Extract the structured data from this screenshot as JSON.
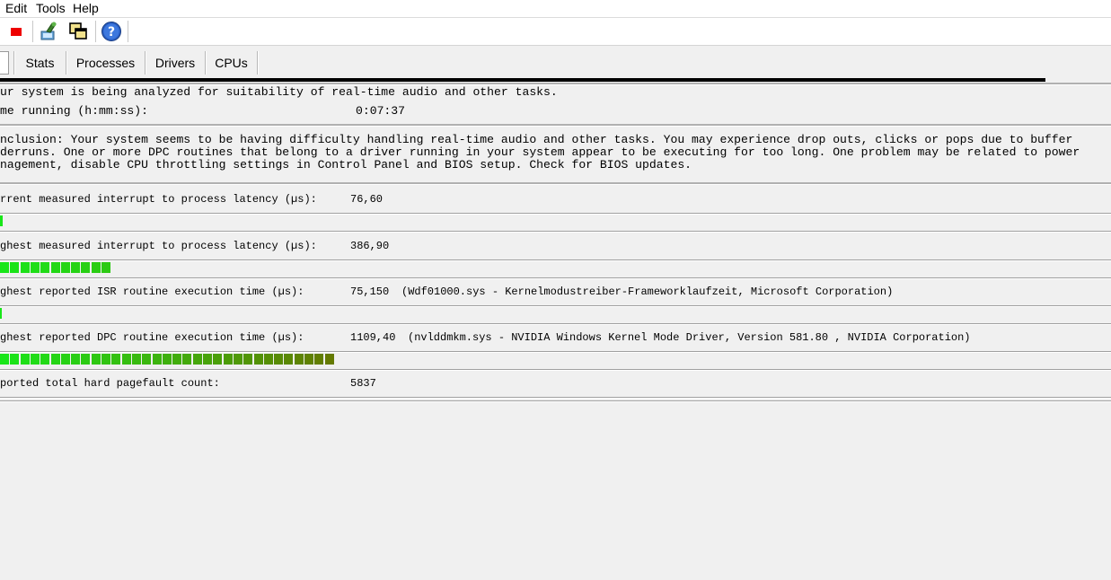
{
  "menu": {
    "items": [
      "Edit",
      "Tools",
      "Help"
    ]
  },
  "toolbar": {
    "buttons": [
      {
        "name": "stop-icon",
        "color": "#ee0000"
      },
      {
        "name": "analyze-icon",
        "color": "#3a7f2a"
      },
      {
        "name": "windows-icon",
        "color": "#f2e28c"
      },
      {
        "name": "help-icon",
        "color": "#2a5fc4"
      }
    ]
  },
  "tabs": [
    "Stats",
    "Processes",
    "Drivers",
    "CPUs"
  ],
  "stats": {
    "status_line": "ur system is being analyzed for suitability of real-time audio and other tasks.",
    "time_label": "me running (h:mm:ss):",
    "time_value": "0:07:37",
    "conclusion_1": "nclusion: Your system seems to be having difficulty handling real-time audio and other tasks. You may experience drop outs, clicks or pops due to buffer",
    "conclusion_2": "derruns. One or more DPC routines that belong to a driver running in your system appear to be executing for too long. One problem may be related to power",
    "conclusion_3": "nagement, disable CPU throttling settings in Control Panel and BIOS setup. Check for BIOS updates.",
    "metrics": [
      {
        "label": "rrent measured interrupt to process latency (µs):",
        "value": "76,60",
        "detail": "",
        "bar_segments": 1
      },
      {
        "label": "ghest measured interrupt to process latency (µs):",
        "value": "386,90",
        "detail": "",
        "bar_segments": 11
      },
      {
        "label": "ghest reported ISR routine execution time (µs):",
        "value": "75,150",
        "detail": "(Wdf01000.sys - Kernelmodustreiber-Frameworklaufzeit, Microsoft Corporation)",
        "bar_segments": 0
      },
      {
        "label": "ghest reported DPC routine execution time (µs):",
        "value": "1109,40",
        "detail": "(nvlddmkm.sys - NVIDIA Windows Kernel Mode Driver, Version 581.80 , NVIDIA Corporation)",
        "bar_segments": 33
      },
      {
        "label": "ported total hard pagefault count:",
        "value": "5837",
        "detail": "",
        "bar_segments": null
      }
    ],
    "colors": {
      "bar_green": "#19e619",
      "bar_olive": "#667700"
    }
  }
}
